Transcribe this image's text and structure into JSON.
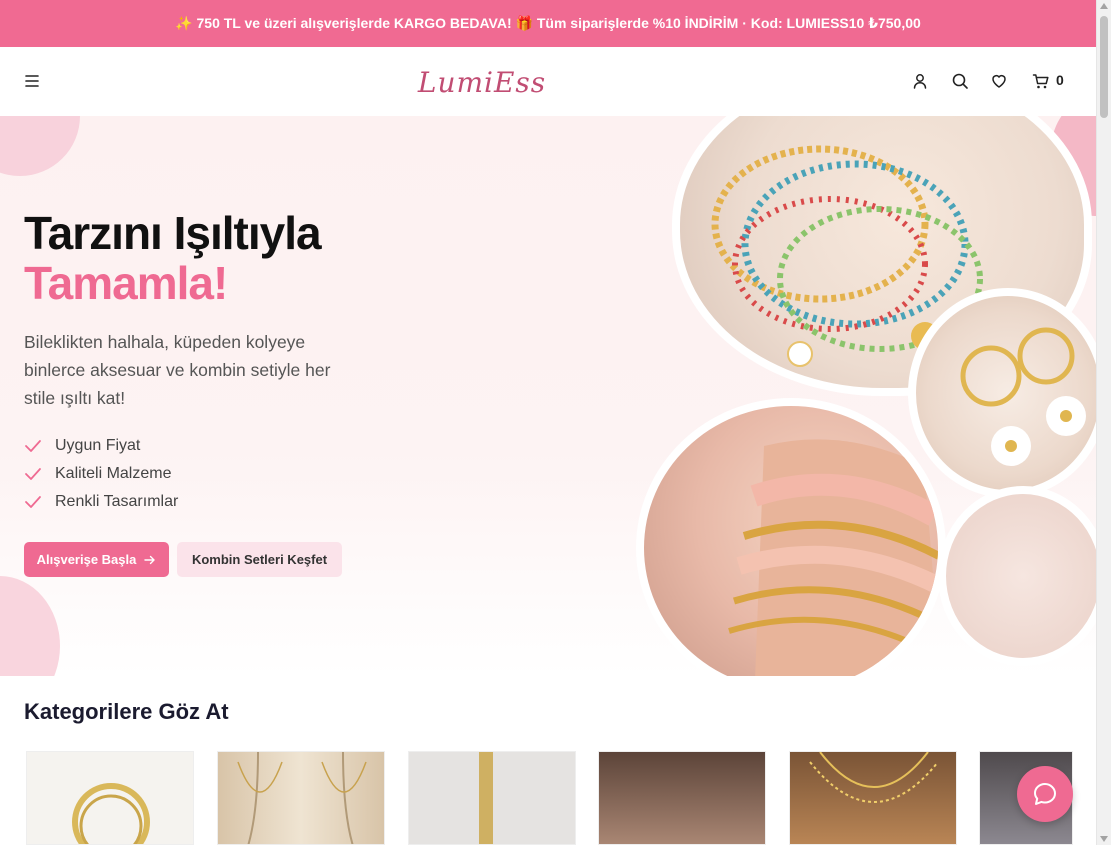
{
  "announcement": {
    "text": "✨ 750 TL ve üzeri alışverişlerde KARGO BEDAVA! 🎁 Tüm siparişlerde %10 İNDİRİM · Kod: LUMIESS10 ₺750,00"
  },
  "header": {
    "logo_text": "LumiEss",
    "cart_count": "0",
    "icons": [
      "menu-icon",
      "user-icon",
      "search-icon",
      "heart-icon",
      "cart-icon"
    ]
  },
  "hero": {
    "title_line1": "Tarzını Işıltıyla",
    "title_line2": "Tamamla!",
    "description": "Bileklikten halhala, küpeden kolyeye binlerce aksesuar ve kombin setiyle her stile ışıltı kat!",
    "features": [
      "Uygun Fiyat",
      "Kaliteli Malzeme",
      "Renkli Tasarımlar"
    ],
    "primary_button": "Alışverişe Başla",
    "secondary_button": "Kombin Setleri Keşfet"
  },
  "categories": {
    "title": "Kategorilere Göz At"
  },
  "colors": {
    "brand_pink": "#ef6a92",
    "announcement_bg": "#f06a92",
    "secondary_bg": "#fbe3ea"
  }
}
